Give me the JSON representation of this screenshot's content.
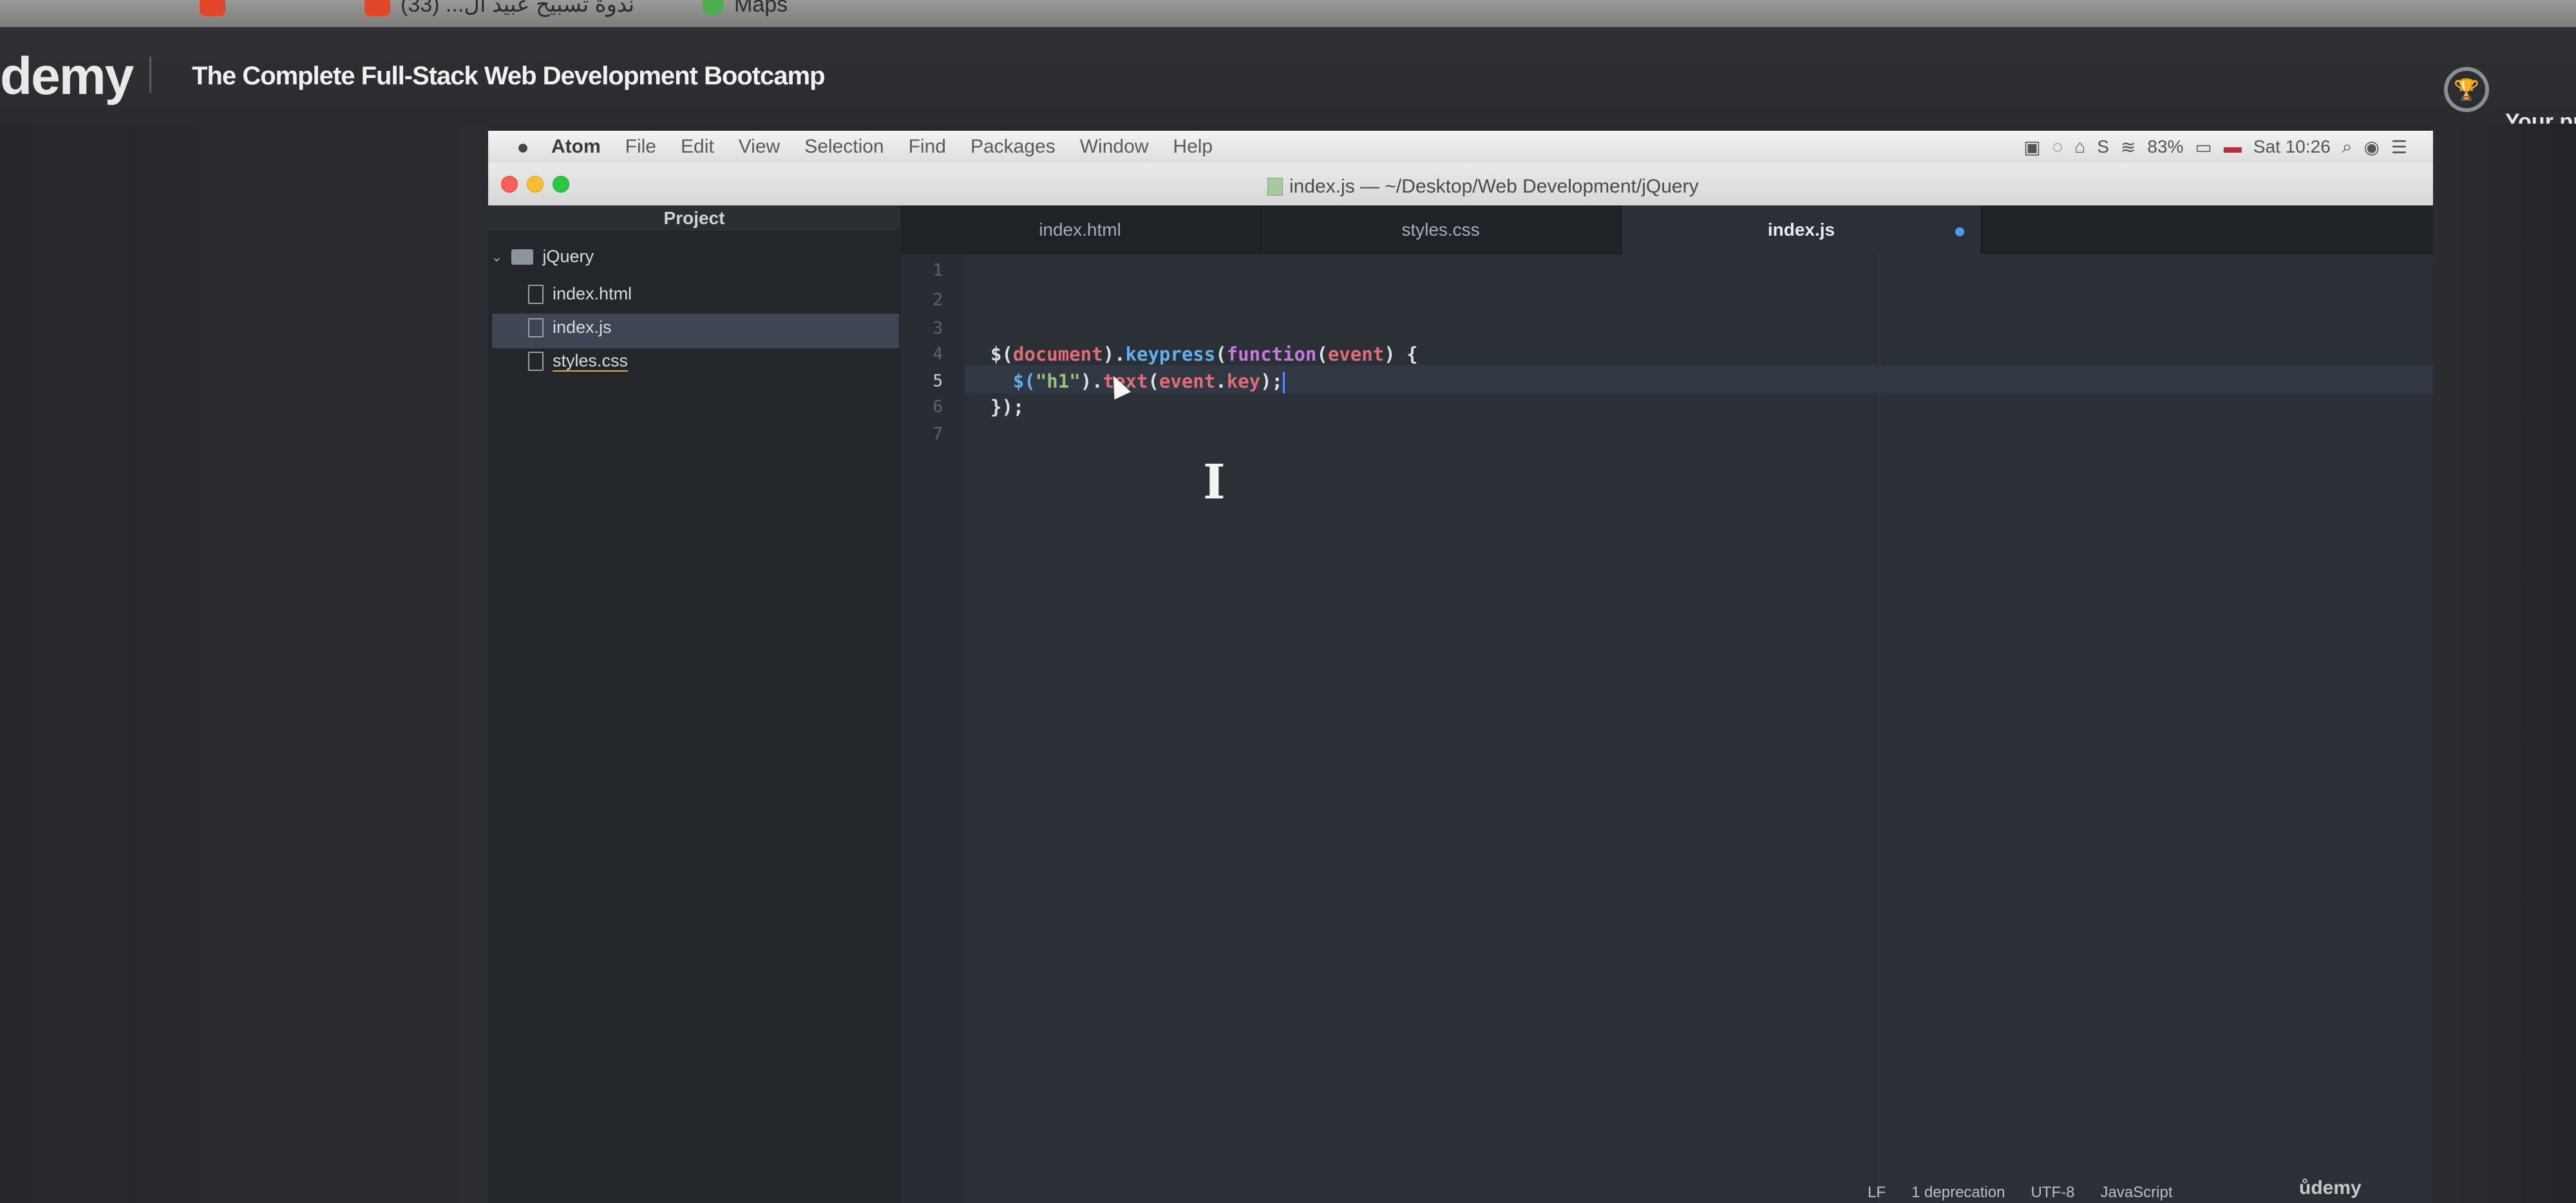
{
  "browser": {
    "bookmarks": [
      {
        "label": "ندوة تسبيح عبيد ال... (33)",
        "icon": "bookmark-favicon"
      },
      {
        "label": "Maps",
        "icon": "maps-pin"
      }
    ]
  },
  "udemy": {
    "logo": "demy",
    "course_title": "The Complete Full-Stack Web Development Bootcamp",
    "progress_label": "Your pr",
    "watermark": "ůdemy"
  },
  "menubar": {
    "apple_icon": "",
    "app_name": "Atom",
    "items": [
      "File",
      "Edit",
      "View",
      "Selection",
      "Find",
      "Packages",
      "Window",
      "Help"
    ],
    "battery": "83%",
    "clock": "Sat 10:26"
  },
  "window": {
    "title": "index.js — ~/Desktop/Web Development/jQuery"
  },
  "tree": {
    "header": "Project",
    "folder": "jQuery",
    "files": [
      "index.html",
      "index.js",
      "styles.css"
    ]
  },
  "tabs": [
    {
      "label": "index.html"
    },
    {
      "label": "styles.css"
    },
    {
      "label": "index.js"
    }
  ],
  "code": {
    "line_numbers": [
      "1",
      "2",
      "3",
      "4",
      "5",
      "6",
      "7"
    ],
    "line4": {
      "a": "$(",
      "b": "document",
      "c": ").",
      "d": "keypress",
      "e": "(",
      "f": "function",
      "g": "(",
      "h": "event",
      "i": ") {"
    },
    "line5": {
      "a": "  $(",
      "b": "\"h1\"",
      "c": ").",
      "d": "text",
      "e": "(",
      "f": "event",
      "g": ".",
      "h": "key",
      "i": ");"
    },
    "line6": "});"
  },
  "statusbar": {
    "items": [
      "LF",
      "1 deprecation",
      "UTF-8",
      "JavaScript"
    ]
  }
}
